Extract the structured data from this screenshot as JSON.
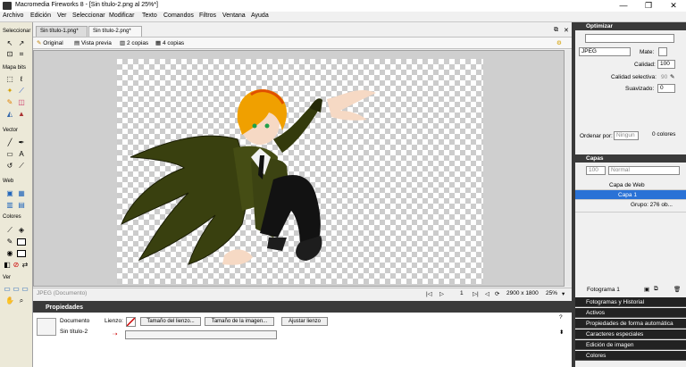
{
  "window": {
    "title": "Macromedia Fireworks 8 - [Sin título-2.png al 25%*]"
  },
  "menu": [
    "Archivo",
    "Edición",
    "Ver",
    "Seleccionar",
    "Modificar",
    "Texto",
    "Comandos",
    "Filtros",
    "Ventana",
    "Ayuda"
  ],
  "tools": {
    "sections": {
      "select": "Seleccionar",
      "bitmap": "Mapa bits",
      "vector": "Vector",
      "web": "Web",
      "colors": "Colores",
      "view": "Ver"
    }
  },
  "doc_tabs": [
    "Sin título-1.png*",
    "Sin título-2.png*"
  ],
  "view_tabs": {
    "original": "Original",
    "preview": "Vista previa",
    "two_up": "2 copias",
    "four_up": "4 copias"
  },
  "status": {
    "format": "JPEG (Documento)",
    "frame": "1",
    "size": "2900 x 1800",
    "zoom": "25%"
  },
  "properties": {
    "title": "Propiedades",
    "kind": "Documento",
    "name": "Sin título-2",
    "canvas_label": "Lienzo:",
    "btn_canvas_size": "Tamaño del lienzo...",
    "btn_image_size": "Tamaño de la imagen...",
    "btn_fit": "Ajustar lienzo"
  },
  "optimize": {
    "title": "Optimizar",
    "format": "JPEG",
    "matte_label": "Mate:",
    "quality_label": "Calidad:",
    "quality": "100",
    "sel_quality_label": "Calidad selectiva:",
    "sel_quality": "90",
    "smoothing_label": "Suavizado:",
    "smoothing": "0",
    "sort_label": "Ordenar por:",
    "sort_value": "Ningun",
    "colors_count": "0 colores"
  },
  "layers": {
    "title": "Capas",
    "opacity": "100",
    "blend": "Normal",
    "rows": [
      "Capa de Web",
      "Capa 1",
      "Grupo: 276 ob..."
    ],
    "frame_label": "Fotograma 1"
  },
  "collapsed_panels": [
    "Fotogramas y Historial",
    "Activos",
    "Propiedades de forma automática",
    "Caracteres especiales",
    "Edición de imagen",
    "Colores"
  ],
  "colors": {
    "accent": "#2a72d6",
    "panel_header": "#3a3a3a"
  }
}
